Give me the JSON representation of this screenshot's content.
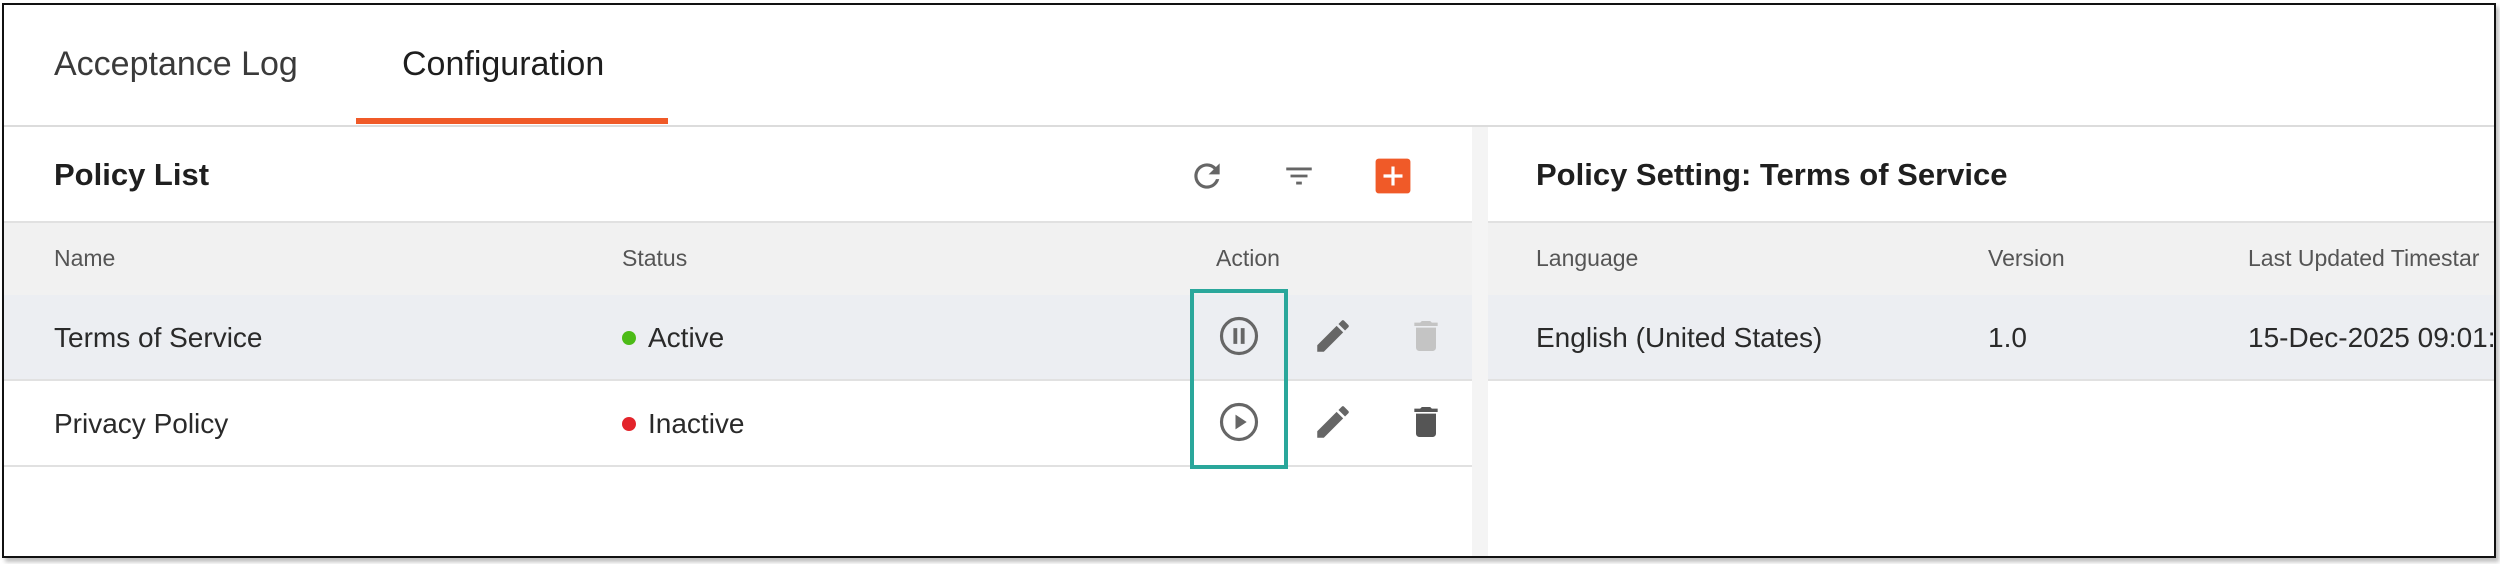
{
  "tabs": [
    {
      "label": "Acceptance Log",
      "active": false
    },
    {
      "label": "Configuration",
      "active": true
    }
  ],
  "policy_list": {
    "title": "Policy List",
    "toolbar": {
      "refresh_icon": "refresh-icon",
      "filter_icon": "filter-icon",
      "add_icon": "plus-icon",
      "accent_color": "#f05a28"
    },
    "columns": {
      "name": "Name",
      "status": "Status",
      "action": "Action"
    },
    "rows": [
      {
        "name": "Terms of Service",
        "status": "Active",
        "status_color": "#4cbb17",
        "toggle_icon": "pause-icon"
      },
      {
        "name": "Privacy Policy",
        "status": "Inactive",
        "status_color": "#e3242b",
        "toggle_icon": "play-icon"
      }
    ]
  },
  "policy_setting": {
    "title": "Policy Setting: Terms of Service",
    "columns": {
      "language": "Language",
      "version": "Version",
      "last_updated": "Last Updated Timestar"
    },
    "rows": [
      {
        "language": "English (United States)",
        "version": "1.0",
        "last_updated": "15-Dec-2025 09:01:"
      }
    ]
  },
  "highlight_color": "#2aa79b"
}
